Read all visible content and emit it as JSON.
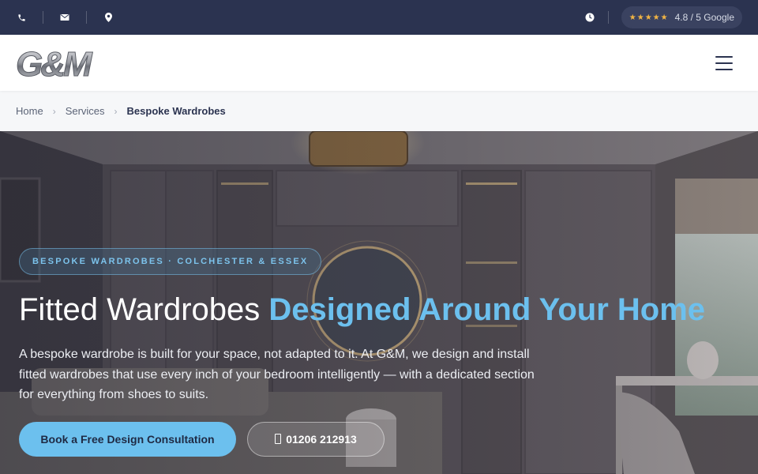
{
  "topbar": {
    "icons": [
      "phone-icon",
      "mail-icon",
      "location-pin-icon",
      "clock-icon"
    ],
    "rating": {
      "stars": "★★★★★",
      "text": "4.8 / 5 Google"
    }
  },
  "header": {
    "logo_text": "G&M",
    "menu_icon": "hamburger-menu-icon"
  },
  "breadcrumb": {
    "items": [
      "Home",
      "Services"
    ],
    "separator": "›",
    "current": "Bespoke Wardrobes"
  },
  "hero": {
    "eyebrow": "BESPOKE WARDROBES · COLCHESTER & ESSEX",
    "title_plain": "Fitted Wardrobes ",
    "title_accent": "Designed Around Your Home",
    "lead": "A bespoke wardrobe is built for your space, not adapted to it. At G&M, we design and install fitted wardrobes that use every inch of your bedroom intelligently — with a dedicated section for everything from shoes to suits.",
    "primary_cta": "Book a Free Design Consultation",
    "phone_cta": "01206 212913"
  },
  "colors": {
    "topbar_bg": "#2b3350",
    "accent": "#6cc0ee",
    "star": "#f2b544"
  }
}
